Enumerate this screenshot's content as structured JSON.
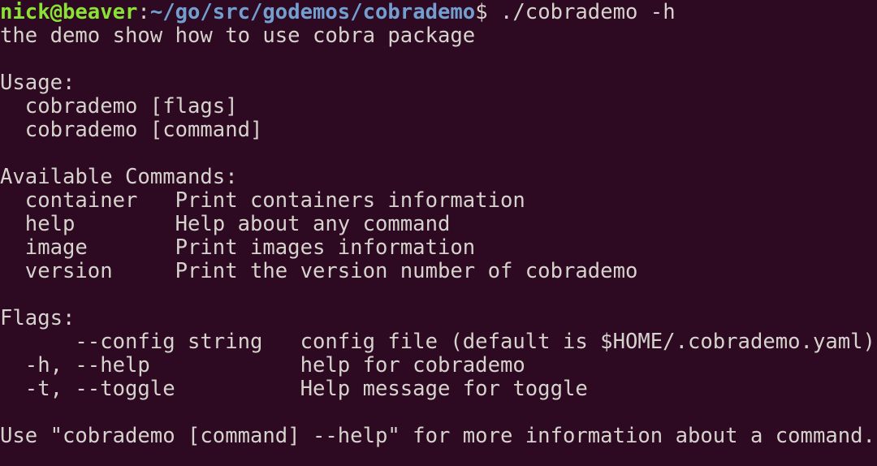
{
  "terminal": {
    "colors": {
      "background": "#2d0922",
      "foreground": "#d6d3cd",
      "user_host": "#8ae234",
      "path": "#729fcf"
    },
    "prompt": {
      "user_host": "nick@beaver",
      "separator": ":",
      "path": "~/go/src/godemos/cobrademo",
      "sigil": "$",
      "command": " ./cobrademo -h"
    },
    "output": {
      "description": "the demo show how to use cobra package",
      "usage_heading": "Usage:",
      "usage_lines": [
        "  cobrademo [flags]",
        "  cobrademo [command]"
      ],
      "commands_heading": "Available Commands:",
      "commands": [
        "  container   Print containers information",
        "  help        Help about any command",
        "  image       Print images information",
        "  version     Print the version number of cobrademo"
      ],
      "flags_heading": "Flags:",
      "flags": [
        "      --config string   config file (default is $HOME/.cobrademo.yaml)",
        "  -h, --help            help for cobrademo",
        "  -t, --toggle          Help message for toggle"
      ],
      "footer": "Use \"cobrademo [command] --help\" for more information about a command."
    }
  }
}
